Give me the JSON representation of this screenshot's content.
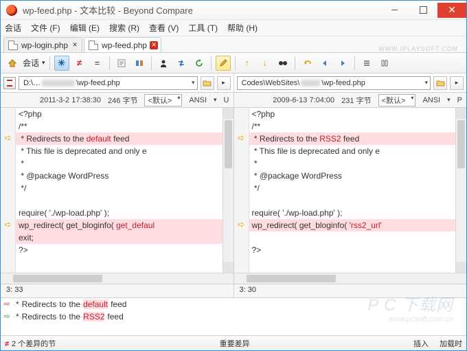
{
  "window": {
    "title": "wp-feed.php - 文本比较 - Beyond Compare"
  },
  "menu": {
    "session": "会话",
    "file": "文件 (F)",
    "edit": "编辑 (E)",
    "search": "搜索 (R)",
    "view": "查看 (V)",
    "tools": "工具 (T)",
    "help": "帮助 (H)"
  },
  "tabs": [
    {
      "label": "wp-login.php",
      "active": false
    },
    {
      "label": "wp-feed.php",
      "active": true
    }
  ],
  "brand_watermark": "WWW.IPLAYSOFT.COM",
  "toolbar": {
    "session_label": "会话"
  },
  "left": {
    "path_prefix": "D:\\…",
    "path_suffix": "\\wp-feed.php",
    "date": "2011-3-2 17:38:30",
    "size": "246 字节",
    "default": "<默认>",
    "encoding": "ANSI",
    "lineend": "U",
    "code": [
      {
        "t": "<?php",
        "d": false
      },
      {
        "t": "/**",
        "d": false
      },
      {
        "t": " * Redirects to the default feed",
        "d": true,
        "hl": "default"
      },
      {
        "t": " * This file is deprecated and only e",
        "d": false
      },
      {
        "t": " *",
        "d": false
      },
      {
        "t": " * @package WordPress",
        "d": false
      },
      {
        "t": " */",
        "d": false
      },
      {
        "t": "",
        "d": false
      },
      {
        "t": "require( './wp-load.php' );",
        "d": false
      },
      {
        "t": "wp_redirect( get_bloginfo( get_defaul",
        "d": true,
        "hl": "get_defaul"
      },
      {
        "t": "exit;",
        "d": true
      },
      {
        "t": "?>",
        "d": false
      }
    ],
    "pos": "3: 33"
  },
  "right": {
    "path_prefix": "Codes\\WebSites\\",
    "path_suffix": "\\wp-feed.php",
    "date": "2009-6-13 7:04:00",
    "size": "231 字节",
    "default": "<默认>",
    "encoding": "ANSI",
    "lineend": "P",
    "code": [
      {
        "t": "<?php",
        "d": false
      },
      {
        "t": "/**",
        "d": false
      },
      {
        "t": " * Redirects to the RSS2 feed",
        "d": true,
        "hl": "RSS2"
      },
      {
        "t": " * This file is deprecated and only e",
        "d": false
      },
      {
        "t": " *",
        "d": false
      },
      {
        "t": " * @package WordPress",
        "d": false
      },
      {
        "t": " */",
        "d": false
      },
      {
        "t": "",
        "d": false
      },
      {
        "t": "require( './wp-load.php' );",
        "d": false
      },
      {
        "t": "wp_redirect( get_bloginfo( 'rss2_url'",
        "d": true,
        "hl": "'rss2_url'"
      },
      {
        "t": "",
        "d": false
      },
      {
        "t": "?>",
        "d": false
      }
    ],
    "pos": "3: 30"
  },
  "diff_detail": {
    "line1": {
      "pre": " * Redirects to the ",
      "word": "default",
      "post": " feed"
    },
    "line2": {
      "pre": " * Redirects to the ",
      "word": "RSS2",
      "post": " feed"
    }
  },
  "status": {
    "diff_count": "2 个差异的节",
    "important": "重要差异",
    "insert": "插入",
    "loaded": "加载时"
  },
  "page_watermark": {
    "big": "P C 下载网",
    "small": "www.pcsoft.com.cn"
  }
}
